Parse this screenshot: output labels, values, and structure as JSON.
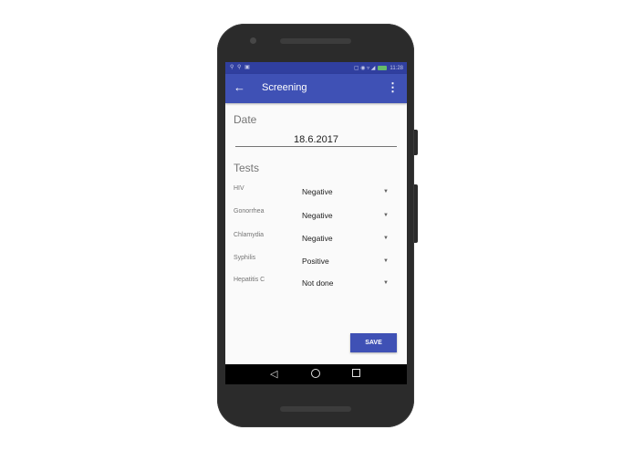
{
  "status_bar": {
    "time": "11:28",
    "left_icons": "⚲ ⚲ ▣",
    "right_icons": "▢ ◉ ▿ ◢"
  },
  "app_bar": {
    "back_icon": "arrow-back-icon",
    "title": "Screening",
    "menu_icon": "more-vert-icon"
  },
  "date_section": {
    "heading": "Date",
    "value": "18.6.2017"
  },
  "tests_section": {
    "heading": "Tests",
    "rows": [
      {
        "label": "HIV",
        "value": "Negative"
      },
      {
        "label": "Gonorrhea",
        "value": "Negative"
      },
      {
        "label": "Chlamydia",
        "value": "Negative"
      },
      {
        "label": "Syphilis",
        "value": "Positive"
      },
      {
        "label": "Hepatitis C",
        "value": "Not done"
      }
    ]
  },
  "save_label": "SAVE",
  "colors": {
    "primary": "#3f51b5",
    "primary_dark": "#303f9f",
    "background": "#fafafa"
  }
}
